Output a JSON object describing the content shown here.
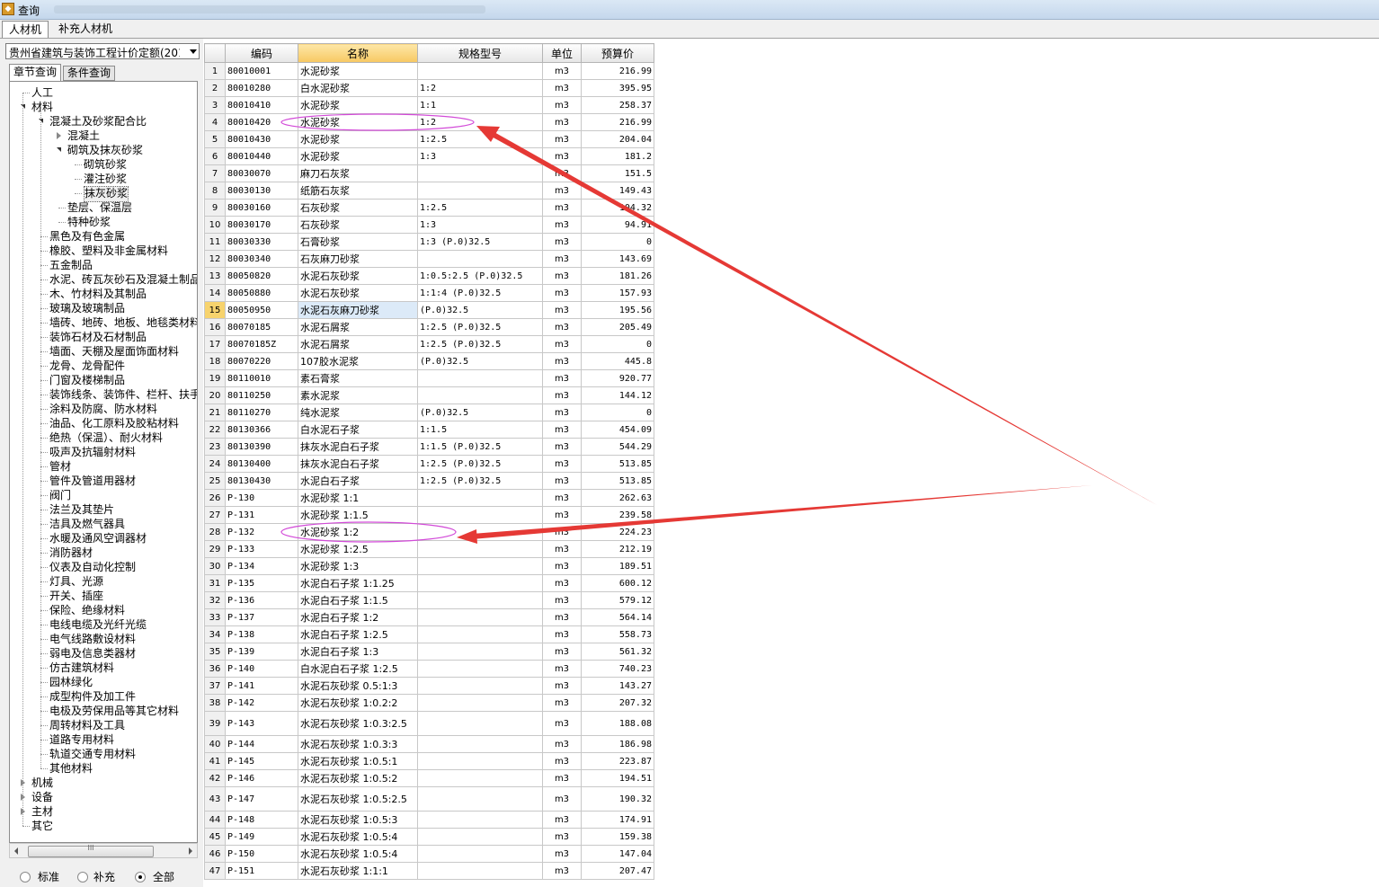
{
  "window": {
    "title": "查询"
  },
  "tabs": [
    {
      "label": "人材机"
    },
    {
      "label": "补充人材机"
    }
  ],
  "left_panel": {
    "quota_select": "贵州省建筑与装饰工程计价定额(201",
    "subtabs": [
      {
        "label": "章节查询"
      },
      {
        "label": "条件查询"
      }
    ],
    "tree": [
      "人工",
      "材料",
      "混凝土及砂浆配合比",
      "混凝土",
      "砌筑及抹灰砂浆",
      "砌筑砂浆",
      "灌注砂浆",
      "抹灰砂浆",
      "垫层、保温层",
      "特种砂浆",
      "黑色及有色金属",
      "橡胶、塑料及非金属材料",
      "五金制品",
      "水泥、砖瓦灰砂石及混凝土制品",
      "木、竹材料及其制品",
      "玻璃及玻璃制品",
      "墙砖、地砖、地板、地毯类材料",
      "装饰石材及石材制品",
      "墙面、天棚及屋面饰面材料",
      "龙骨、龙骨配件",
      "门窗及楼梯制品",
      "装饰线条、装饰件、栏杆、扶手",
      "涂料及防腐、防水材料",
      "油品、化工原料及胶粘材料",
      "绝热（保温）、耐火材料",
      "吸声及抗辐射材料",
      "管材",
      "管件及管道用器材",
      "阀门",
      "法兰及其垫片",
      "洁具及燃气器具",
      "水暖及通风空调器材",
      "消防器材",
      "仪表及自动化控制",
      "灯具、光源",
      "开关、插座",
      "保险、绝缘材料",
      "电线电缆及光纤光缆",
      "电气线路敷设材料",
      "弱电及信息类器材",
      "仿古建筑材料",
      "园林绿化",
      "成型构件及加工件",
      "电极及劳保用品等其它材料",
      "周转材料及工具",
      "道路专用材料",
      "轨道交通专用材料",
      "其他材料",
      "机械",
      "设备",
      "主材",
      "其它"
    ],
    "scroll_label": "III",
    "radios": [
      {
        "label": "标准"
      },
      {
        "label": "补充"
      },
      {
        "label": "全部"
      }
    ]
  },
  "grid": {
    "headers": [
      "",
      "编码",
      "名称",
      "规格型号",
      "单位",
      "预算价"
    ],
    "rows": [
      [
        "1",
        "80010001",
        "水泥砂浆",
        "",
        "m3",
        "216.99"
      ],
      [
        "2",
        "80010280",
        "白水泥砂浆",
        "1:2",
        "m3",
        "395.95"
      ],
      [
        "3",
        "80010410",
        "水泥砂浆",
        "1:1",
        "m3",
        "258.37"
      ],
      [
        "4",
        "80010420",
        "水泥砂浆",
        "1:2",
        "m3",
        "216.99"
      ],
      [
        "5",
        "80010430",
        "水泥砂浆",
        "1:2.5",
        "m3",
        "204.04"
      ],
      [
        "6",
        "80010440",
        "水泥砂浆",
        "1:3",
        "m3",
        "181.2"
      ],
      [
        "7",
        "80030070",
        "麻刀石灰浆",
        "",
        "m3",
        "151.5"
      ],
      [
        "8",
        "80030130",
        "纸筋石灰浆",
        "",
        "m3",
        "149.43"
      ],
      [
        "9",
        "80030160",
        "石灰砂浆",
        "1:2.5",
        "m3",
        "104.32"
      ],
      [
        "10",
        "80030170",
        "石灰砂浆",
        "1:3",
        "m3",
        "94.91"
      ],
      [
        "11",
        "80030330",
        "石膏砂浆",
        "1:3 (P.0)32.5",
        "m3",
        "0"
      ],
      [
        "12",
        "80030340",
        "石灰麻刀砂浆",
        "",
        "m3",
        "143.69"
      ],
      [
        "13",
        "80050820",
        "水泥石灰砂浆",
        "1:0.5:2.5 (P.0)32.5",
        "m3",
        "181.26"
      ],
      [
        "14",
        "80050880",
        "水泥石灰砂浆",
        "1:1:4 (P.0)32.5",
        "m3",
        "157.93"
      ],
      [
        "15",
        "80050950",
        "水泥石灰麻刀砂浆",
        "(P.0)32.5",
        "m3",
        "195.56"
      ],
      [
        "16",
        "80070185",
        "水泥石屑浆",
        "1:2.5 (P.0)32.5",
        "m3",
        "205.49"
      ],
      [
        "17",
        "80070185Z",
        "水泥石屑浆",
        "1:2.5 (P.0)32.5",
        "m3",
        "0"
      ],
      [
        "18",
        "80070220",
        "107胶水泥浆",
        "(P.0)32.5",
        "m3",
        "445.8"
      ],
      [
        "19",
        "80110010",
        "素石膏浆",
        "",
        "m3",
        "920.77"
      ],
      [
        "20",
        "80110250",
        "素水泥浆",
        "",
        "m3",
        "144.12"
      ],
      [
        "21",
        "80110270",
        "纯水泥浆",
        "(P.0)32.5",
        "m3",
        "0"
      ],
      [
        "22",
        "80130366",
        "白水泥石子浆",
        "1:1.5",
        "m3",
        "454.09"
      ],
      [
        "23",
        "80130390",
        "抹灰水泥白石子浆",
        "1:1.5 (P.0)32.5",
        "m3",
        "544.29"
      ],
      [
        "24",
        "80130400",
        "抹灰水泥白石子浆",
        "1:2.5 (P.0)32.5",
        "m3",
        "513.85"
      ],
      [
        "25",
        "80130430",
        "水泥白石子浆",
        "1:2.5 (P.0)32.5",
        "m3",
        "513.85"
      ],
      [
        "26",
        "P-130",
        "水泥砂浆 1:1",
        "",
        "m3",
        "262.63"
      ],
      [
        "27",
        "P-131",
        "水泥砂浆 1:1.5",
        "",
        "m3",
        "239.58"
      ],
      [
        "28",
        "P-132",
        "水泥砂浆 1:2",
        "",
        "m3",
        "224.23"
      ],
      [
        "29",
        "P-133",
        "水泥砂浆 1:2.5",
        "",
        "m3",
        "212.19"
      ],
      [
        "30",
        "P-134",
        "水泥砂浆 1:3",
        "",
        "m3",
        "189.51"
      ],
      [
        "31",
        "P-135",
        "水泥白石子浆 1:1.25",
        "",
        "m3",
        "600.12"
      ],
      [
        "32",
        "P-136",
        "水泥白石子浆 1:1.5",
        "",
        "m3",
        "579.12"
      ],
      [
        "33",
        "P-137",
        "水泥白石子浆 1:2",
        "",
        "m3",
        "564.14"
      ],
      [
        "34",
        "P-138",
        "水泥白石子浆 1:2.5",
        "",
        "m3",
        "558.73"
      ],
      [
        "35",
        "P-139",
        "水泥白石子浆 1:3",
        "",
        "m3",
        "561.32"
      ],
      [
        "36",
        "P-140",
        "白水泥白石子浆 1:2.5",
        "",
        "m3",
        "740.23"
      ],
      [
        "37",
        "P-141",
        "水泥石灰砂浆 0.5:1:3",
        "",
        "m3",
        "143.27"
      ],
      [
        "38",
        "P-142",
        "水泥石灰砂浆 1:0.2:2",
        "",
        "m3",
        "207.32"
      ],
      [
        "39",
        "P-143",
        "水泥石灰砂浆 1:0.3:2.5",
        "",
        "m3",
        "188.08"
      ],
      [
        "40",
        "P-144",
        "水泥石灰砂浆 1:0.3:3",
        "",
        "m3",
        "186.98"
      ],
      [
        "41",
        "P-145",
        "水泥石灰砂浆 1:0.5:1",
        "",
        "m3",
        "223.87"
      ],
      [
        "42",
        "P-146",
        "水泥石灰砂浆 1:0.5:2",
        "",
        "m3",
        "194.51"
      ],
      [
        "43",
        "P-147",
        "水泥石灰砂浆 1:0.5:2.5",
        "",
        "m3",
        "190.32"
      ],
      [
        "44",
        "P-148",
        "水泥石灰砂浆 1:0.5:3",
        "",
        "m3",
        "174.91"
      ],
      [
        "45",
        "P-149",
        "水泥石灰砂浆 1:0.5:4",
        "",
        "m3",
        "159.38"
      ],
      [
        "46",
        "P-150",
        "水泥石灰砂浆 1:0.5:4",
        "",
        "m3",
        "147.04"
      ],
      [
        "47",
        "P-151",
        "水泥石灰砂浆 1:1:1",
        "",
        "m3",
        "207.47"
      ]
    ]
  },
  "annotation_colors": {
    "arrow": "#e53935",
    "ellipse": "#d24ad8"
  }
}
